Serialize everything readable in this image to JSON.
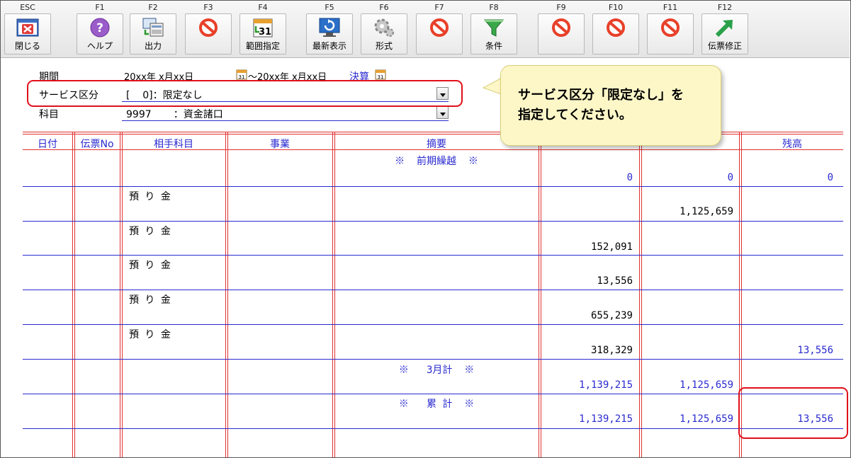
{
  "toolbar": {
    "buttons": [
      {
        "key": "ESC",
        "label": "閉じる",
        "icon": "close-window-icon"
      },
      {
        "key": "F1",
        "label": "ヘルプ",
        "icon": "help-icon"
      },
      {
        "key": "F2",
        "label": "出力",
        "icon": "output-icon"
      },
      {
        "key": "F3",
        "label": "",
        "icon": "disabled-icon"
      },
      {
        "key": "F4",
        "label": "範囲指定",
        "icon": "calendar-icon"
      },
      {
        "key": "F5",
        "label": "最新表示",
        "icon": "refresh-icon"
      },
      {
        "key": "F6",
        "label": "形式",
        "icon": "gear-icon"
      },
      {
        "key": "F7",
        "label": "",
        "icon": "disabled-icon"
      },
      {
        "key": "F8",
        "label": "条件",
        "icon": "filter-icon"
      },
      {
        "key": "F9",
        "label": "",
        "icon": "disabled-icon"
      },
      {
        "key": "F10",
        "label": "",
        "icon": "disabled-icon"
      },
      {
        "key": "F11",
        "label": "",
        "icon": "disabled-icon"
      },
      {
        "key": "F12",
        "label": "伝票修正",
        "icon": "edit-arrow-icon"
      }
    ]
  },
  "header": {
    "period_label": "期間",
    "period_from": "20xx年 x月xx日",
    "period_to": "～20xx年 x月xx日",
    "settle_label": "決算",
    "service_label": "サービス区分",
    "service_value": "[    0]：限定なし",
    "account_label": "科目",
    "account_value": "9997       ：資金諸口"
  },
  "table": {
    "columns": [
      "日付",
      "伝票No",
      "相手科目",
      "事業",
      "摘要",
      "",
      "",
      "残高"
    ],
    "rows": [
      {
        "date": "",
        "slip": "",
        "account": "",
        "business": "",
        "memo": "※  前期繰越  ※",
        "debit": "0",
        "credit": "0",
        "balance": "0"
      },
      {
        "date": "",
        "slip": "",
        "account": "預 り 金",
        "business": "",
        "memo": "",
        "debit": "",
        "credit": "1,125,659",
        "balance": ""
      },
      {
        "date": "",
        "slip": "",
        "account": "預 り 金",
        "business": "",
        "memo": "",
        "debit": "152,091",
        "credit": "",
        "balance": ""
      },
      {
        "date": "",
        "slip": "",
        "account": "預 り 金",
        "business": "",
        "memo": "",
        "debit": "13,556",
        "credit": "",
        "balance": ""
      },
      {
        "date": "",
        "slip": "",
        "account": "預 り 金",
        "business": "",
        "memo": "",
        "debit": "655,239",
        "credit": "",
        "balance": ""
      },
      {
        "date": "",
        "slip": "",
        "account": "預 り 金",
        "business": "",
        "memo": "",
        "debit": "318,329",
        "credit": "",
        "balance": "13,556"
      },
      {
        "date": "",
        "slip": "",
        "account": "",
        "business": "",
        "memo": "※   3月計  ※",
        "debit": "1,139,215",
        "credit": "1,125,659",
        "balance": ""
      },
      {
        "date": "",
        "slip": "",
        "account": "",
        "business": "",
        "memo": "※   累 計  ※",
        "debit": "1,139,215",
        "credit": "1,125,659",
        "balance": "13,556"
      }
    ]
  },
  "callout": {
    "line1": "サービス区分「限定なし」を",
    "line2": "指定してください。"
  },
  "colors": {
    "grid_red": "#e03030",
    "grid_blue": "#2a2ad0",
    "highlight_red": "#e0101a",
    "callout_bg": "#fdf7c8"
  }
}
